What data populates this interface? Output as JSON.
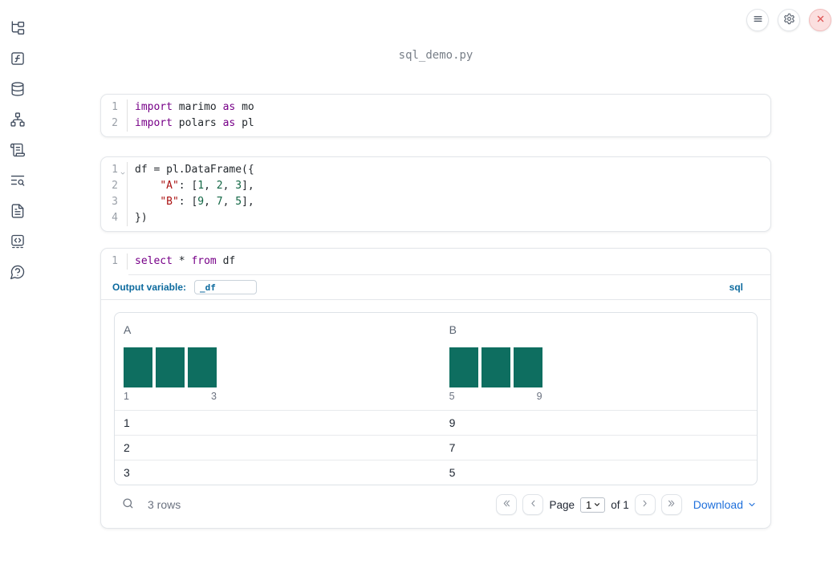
{
  "window": {
    "title": "sql_demo.py"
  },
  "topbar": {
    "buttons": [
      {
        "name": "menu",
        "icon": "hamburger-icon"
      },
      {
        "name": "settings",
        "icon": "gear-icon"
      },
      {
        "name": "shutdown",
        "icon": "close-icon"
      }
    ]
  },
  "sidebar": {
    "items": [
      {
        "name": "file-explorer",
        "icon": "folder-tree-icon"
      },
      {
        "name": "variables",
        "icon": "function-square-icon"
      },
      {
        "name": "data-sources",
        "icon": "database-icon"
      },
      {
        "name": "dependency-graph",
        "icon": "network-icon"
      },
      {
        "name": "logs",
        "icon": "scroll-text-icon"
      },
      {
        "name": "trace-search",
        "icon": "list-search-icon"
      },
      {
        "name": "documentation",
        "icon": "file-text-icon"
      },
      {
        "name": "snippets",
        "icon": "code-snippet-icon"
      },
      {
        "name": "help",
        "icon": "help-bubble-icon"
      }
    ]
  },
  "cells": [
    {
      "name": "imports-cell",
      "lines": [
        {
          "number": "1",
          "tokens": [
            [
              "kw",
              "import"
            ],
            [
              "pl",
              " marimo "
            ],
            [
              "kw",
              "as"
            ],
            [
              "pl",
              " mo"
            ]
          ]
        },
        {
          "number": "2",
          "tokens": [
            [
              "kw",
              "import"
            ],
            [
              "pl",
              " polars "
            ],
            [
              "kw",
              "as"
            ],
            [
              "pl",
              " pl"
            ]
          ]
        }
      ]
    },
    {
      "name": "dataframe-cell",
      "lines": [
        {
          "number": "1",
          "fold": true,
          "tokens": [
            [
              "pl",
              "df = pl.DataFrame({"
            ]
          ]
        },
        {
          "number": "2",
          "tokens": [
            [
              "pl",
              "    "
            ],
            [
              "str",
              "\"A\""
            ],
            [
              "pl",
              ": ["
            ],
            [
              "num",
              "1"
            ],
            [
              "pl",
              ", "
            ],
            [
              "num",
              "2"
            ],
            [
              "pl",
              ", "
            ],
            [
              "num",
              "3"
            ],
            [
              "pl",
              "],"
            ]
          ]
        },
        {
          "number": "3",
          "tokens": [
            [
              "pl",
              "    "
            ],
            [
              "str",
              "\"B\""
            ],
            [
              "pl",
              ": ["
            ],
            [
              "num",
              "9"
            ],
            [
              "pl",
              ", "
            ],
            [
              "num",
              "7"
            ],
            [
              "pl",
              ", "
            ],
            [
              "num",
              "5"
            ],
            [
              "pl",
              "],"
            ]
          ]
        },
        {
          "number": "4",
          "tokens": [
            [
              "pl",
              "})"
            ]
          ]
        }
      ]
    },
    {
      "name": "sql-cell",
      "lines": [
        {
          "number": "1",
          "tokens": [
            [
              "kw",
              "select"
            ],
            [
              "pl",
              " * "
            ],
            [
              "kw",
              "from"
            ],
            [
              "pl",
              " df"
            ]
          ]
        }
      ]
    }
  ],
  "sql": {
    "output_variable_label": "Output variable:",
    "output_variable_value": "_df",
    "language_label": "sql"
  },
  "table": {
    "col_widths": [
      "50.7%",
      "49.3%"
    ],
    "columns": [
      {
        "label": "A",
        "hist": {
          "bar_heights": [
            1,
            1,
            1
          ],
          "min_label": "1",
          "max_label": "3"
        }
      },
      {
        "label": "B",
        "hist": {
          "bar_heights": [
            1,
            1,
            1
          ],
          "min_label": "5",
          "max_label": "9"
        }
      }
    ],
    "rows": [
      [
        "1",
        "9"
      ],
      [
        "2",
        "7"
      ],
      [
        "3",
        "5"
      ]
    ],
    "footer": {
      "row_count": "3 rows",
      "page_label": "Page",
      "page_value": "1",
      "of_label": "of 1",
      "download_label": "Download"
    }
  },
  "colors": {
    "accent_blue": "#0c6a9e",
    "link_blue": "#1e6fdb",
    "hist_bar": "#0e6e60",
    "keyword": "#770088",
    "string": "#aa1111",
    "number": "#116644"
  }
}
